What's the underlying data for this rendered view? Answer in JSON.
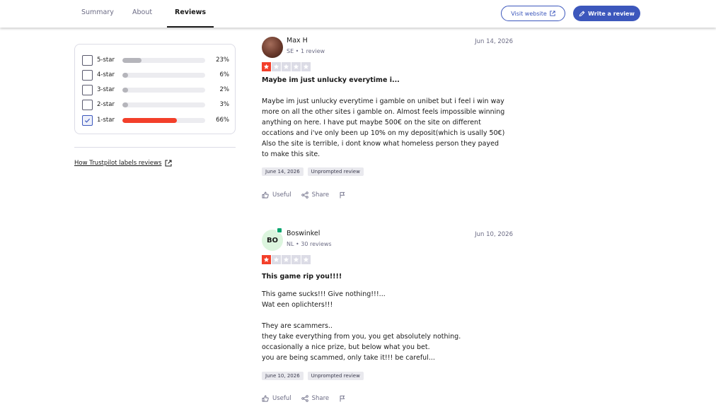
{
  "nav": {
    "tabs": [
      {
        "label": "Summary"
      },
      {
        "label": "About"
      },
      {
        "label": "Reviews"
      }
    ],
    "visit_website": "Visit website",
    "write_review": "Write a review"
  },
  "filter": {
    "rows": [
      {
        "label": "5-star",
        "percent": "23%",
        "fraction": 0.23,
        "checked": false
      },
      {
        "label": "4-star",
        "percent": "6%",
        "fraction": 0.06,
        "checked": false
      },
      {
        "label": "3-star",
        "percent": "2%",
        "fraction": 0.02,
        "checked": false
      },
      {
        "label": "2-star",
        "percent": "3%",
        "fraction": 0.03,
        "checked": false
      },
      {
        "label": "1-star",
        "percent": "66%",
        "fraction": 0.66,
        "checked": true
      }
    ],
    "how_link": "How Trustpilot labels reviews"
  },
  "colors": {
    "accent": "#3c57bc",
    "star_red": "#f33f2a",
    "verified": "#04a56e"
  },
  "reviews": [
    {
      "name": "Max H",
      "meta": "SE • 1 review",
      "date": "Jun 14, 2026",
      "rating": 1,
      "title": "Maybe im just unlucky everytime i...",
      "body": "Maybe im just unlucky everytime i gamble on unibet but i feel i win way\nmore on all the other sites i gamble on. Almost feels impossible winning\nanything on here. I have put maybe 500€ on the site on different\noccations and i've only been up 10% on my deposit(which is usally 50€)\nAlso the site is terrible, i dont know what homeless person they payed\nto make this site.",
      "chip_date": "June 14, 2026",
      "chip_label": "Unprompted review",
      "useful": "Useful",
      "share": "Share"
    },
    {
      "name": "Boswinkel",
      "initials": "BO",
      "meta": "NL • 30 reviews",
      "date": "Jun 10, 2026",
      "rating": 1,
      "title": "This game rip you!!!!",
      "body": "This game sucks!!! Give nothing!!!...\nWat een oplichters!!!\n\nThey are scammers..\nthey take everything from you, you get absolutely nothing.\noccasionally a nice prize, but below what you bet.\nyou are being scammed, only take it!!! be careful...",
      "chip_date": "June 10, 2026",
      "chip_label": "Unprompted review",
      "useful": "Useful",
      "share": "Share"
    }
  ]
}
